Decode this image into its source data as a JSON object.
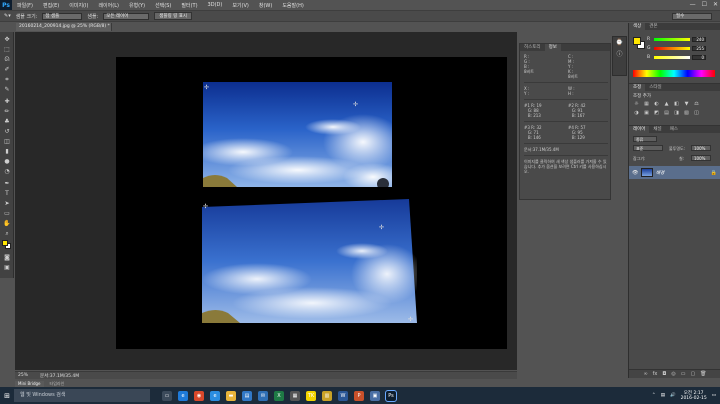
{
  "app": {
    "logo": "Ps",
    "menu": [
      "파일(F)",
      "편집(E)",
      "이미지(I)",
      "레이어(L)",
      "유형(Y)",
      "선택(S)",
      "필터(T)",
      "3D(D)",
      "보기(V)",
      "창(W)",
      "도움말(H)"
    ],
    "window_controls": [
      "—",
      "☐",
      "✕"
    ]
  },
  "options_bar": {
    "sample_size_label": "샘플 크기:",
    "sample_size_value": "점 샘플",
    "sample_label": "샘플:",
    "sample_value": "모든 레이어",
    "sample_button": "샘플링 링 표시",
    "workspace": "필수"
  },
  "document": {
    "tab_title": "20160214_200914.jpg @ 25% (RGB/8) *",
    "status_zoom": "25%",
    "status_doc": "문서:37.1M/35.4M"
  },
  "mini_bridge": {
    "tabs": [
      "Mini Bridge",
      "타임라인"
    ]
  },
  "info_panel": {
    "tabs": [
      "히스토리",
      "정보"
    ],
    "top_left": [
      "R :",
      "G :",
      "B :"
    ],
    "top_right": [
      "C :",
      "M :",
      "Y :",
      "K :"
    ],
    "bits_left": "8비트",
    "bits_right": "8비트",
    "xy_left": [
      "X :",
      "Y :"
    ],
    "wh_right": [
      "W :",
      "H :"
    ],
    "sample1": {
      "label": "#1",
      "r": "19",
      "g": "88",
      "b": "213"
    },
    "sample2": {
      "label": "#2",
      "r": "42",
      "g": "91",
      "b": "167"
    },
    "sample3": {
      "label": "#3",
      "r": "32",
      "g": "71",
      "b": "146"
    },
    "sample4": {
      "label": "#4",
      "r": "57",
      "g": "95",
      "b": "129"
    },
    "doc_size": "문서:37.1M/35.4M",
    "hint": "이미지를 클릭하여 새 색상 샘플러를 가져올 수 있습니다. 추가 옵션을 보려면 Ctrl 키를 사용하십시오."
  },
  "color_panel": {
    "tabs": [
      "색상",
      "견본"
    ],
    "r": {
      "label": "R",
      "value": "240"
    },
    "g": {
      "label": "G",
      "value": "255"
    },
    "b": {
      "label": "B",
      "value": "0"
    }
  },
  "adjust_panel": {
    "tabs": [
      "조정",
      "스타일"
    ],
    "title": "조정 추가",
    "icons": [
      "☼",
      "▦",
      "◐",
      "▲",
      "◧",
      "▼",
      "⚖",
      "◑",
      "▣",
      "◩",
      "▤",
      "◨",
      "▧",
      "◫"
    ]
  },
  "layers_panel": {
    "tabs": [
      "레이어",
      "채널",
      "패스"
    ],
    "kind": "종류",
    "blend": "표준",
    "opacity_label": "불투명도:",
    "opacity": "100%",
    "lock_label": "잠그기:",
    "fill_label": "칠:",
    "fill": "100%",
    "layer_name": "배경",
    "footer_icons": [
      "∞",
      "fx",
      "◘",
      "◎",
      "▭",
      "▢",
      "🗑"
    ]
  },
  "taskbar": {
    "start": "⊞",
    "search_placeholder": "웹 및 Windows 검색",
    "time": "오전 2:17",
    "date": "2016-02-15",
    "apps": [
      {
        "name": "task-view",
        "color": "#3b4a5a",
        "glyph": "▭"
      },
      {
        "name": "edge",
        "color": "#1e7ad9",
        "glyph": "e"
      },
      {
        "name": "chrome",
        "color": "#d9482b",
        "glyph": "◉"
      },
      {
        "name": "ie",
        "color": "#2a8de0",
        "glyph": "e"
      },
      {
        "name": "explorer",
        "color": "#e8b43a",
        "glyph": "▬"
      },
      {
        "name": "store",
        "color": "#3178c6",
        "glyph": "▤"
      },
      {
        "name": "mail",
        "color": "#2f6fb5",
        "glyph": "✉"
      },
      {
        "name": "excel",
        "color": "#1e7a45",
        "glyph": "X"
      },
      {
        "name": "calculator",
        "color": "#555",
        "glyph": "▦"
      },
      {
        "name": "kakaotalk",
        "color": "#f2d500",
        "glyph": "TK"
      },
      {
        "name": "notes",
        "color": "#c9a227",
        "glyph": "▥"
      },
      {
        "name": "word",
        "color": "#2b5797",
        "glyph": "W"
      },
      {
        "name": "powerpoint",
        "color": "#c8502a",
        "glyph": "P"
      },
      {
        "name": "photos",
        "color": "#4a6fa5",
        "glyph": "▣"
      },
      {
        "name": "photoshop",
        "color": "#0d1d2e",
        "glyph": "Ps"
      }
    ]
  }
}
